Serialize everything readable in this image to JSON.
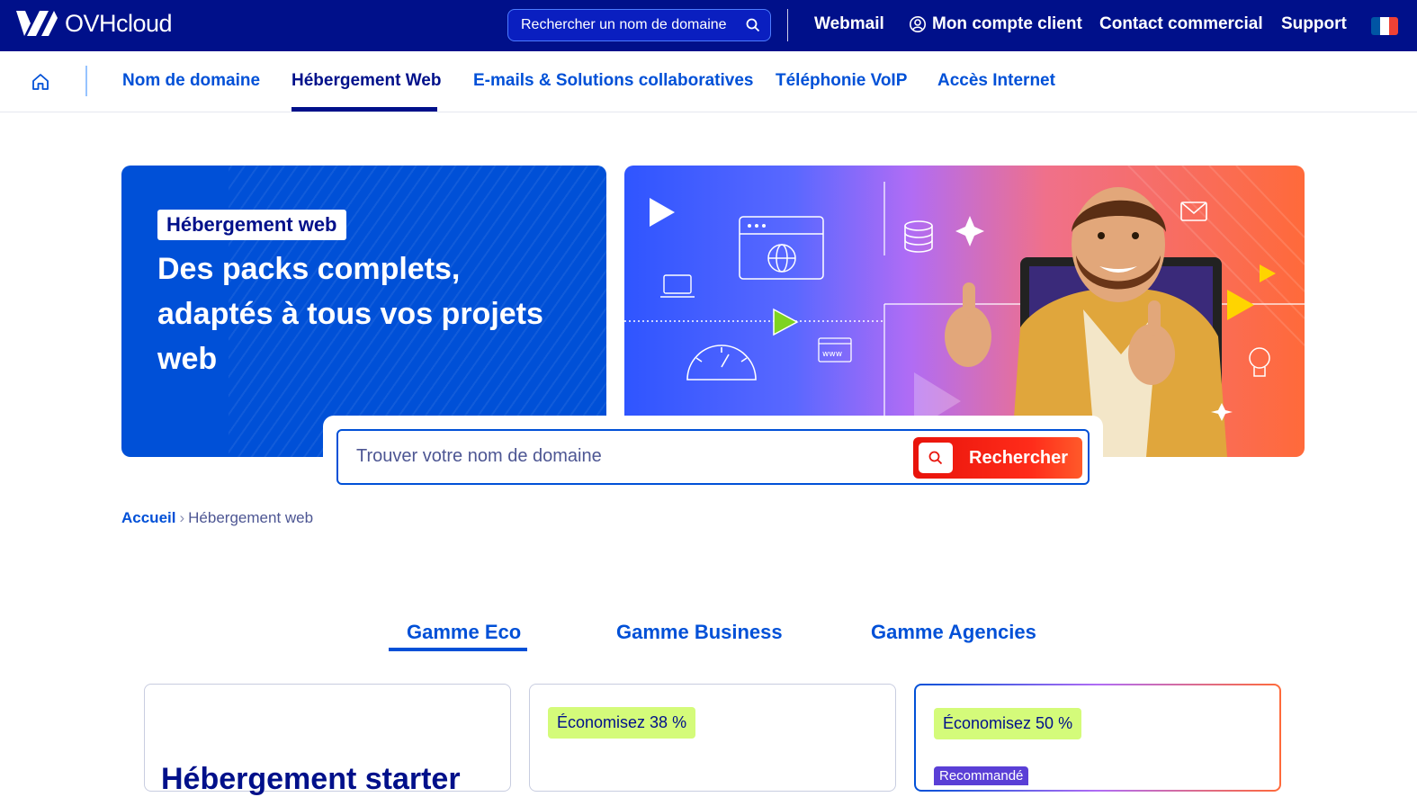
{
  "topbar": {
    "brand": "OVHcloud",
    "search_placeholder": "Rechercher un nom de domaine",
    "links": [
      "Webmail",
      "Mon compte client",
      "Contact commercial",
      "Support"
    ],
    "flag_colors": [
      "#0055a4",
      "#ffffff",
      "#ef4135"
    ]
  },
  "subnav": {
    "items": [
      "Nom de domaine",
      "Hébergement Web",
      "E-mails & Solutions collaboratives",
      "Téléphonie VoIP",
      "Accès Internet"
    ],
    "active": "Hébergement Web"
  },
  "hero": {
    "tag": "Hébergement web",
    "title": "Des packs complets, adaptés à tous vos projets web",
    "domain_placeholder": "Trouver votre nom de domaine",
    "domain_button": "Rechercher"
  },
  "breadcrumb": {
    "home": "Accueil",
    "current": "Hébergement web"
  },
  "tabs": [
    "Gamme Eco",
    "Gamme Business",
    "Gamme Agencies"
  ],
  "cards": [
    {
      "badge": "",
      "title": "Hébergement starter"
    },
    {
      "badge": "Économisez 38 %"
    },
    {
      "badge": "Économisez 50 %",
      "tag": "Recommandé"
    }
  ],
  "colors": {
    "brand_dark": "#00108a",
    "brand_blue": "#0050d7",
    "cta_red": "#e8130b",
    "badge_green": "#d4fb7a"
  }
}
